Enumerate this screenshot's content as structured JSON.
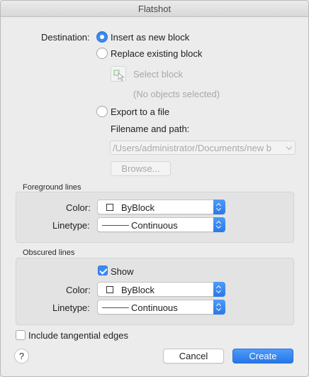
{
  "window": {
    "title": "Flatshot"
  },
  "destination": {
    "label": "Destination:",
    "insert_label": "Insert as new block",
    "replace_label": "Replace existing block",
    "select_block_label": "Select block",
    "no_objects_label": "(No objects selected)",
    "export_label": "Export to a file",
    "filename_label": "Filename and path:",
    "filename_value": "/Users/administrator/Documents/new b",
    "browse_label": "Browse...",
    "selected": "insert"
  },
  "foreground": {
    "title": "Foreground lines",
    "color_label": "Color:",
    "color_value": "ByBlock",
    "linetype_label": "Linetype:",
    "linetype_value": "Continuous"
  },
  "obscured": {
    "title": "Obscured lines",
    "show_label": "Show",
    "show_checked": true,
    "color_label": "Color:",
    "color_value": "ByBlock",
    "linetype_label": "Linetype:",
    "linetype_value": "Continuous"
  },
  "tangential": {
    "label": "Include tangential edges",
    "checked": false
  },
  "footer": {
    "help_label": "?",
    "cancel_label": "Cancel",
    "create_label": "Create"
  },
  "colors": {
    "accent": "#3b89f5",
    "window_bg": "#ececec",
    "group_bg": "#e3e3e3"
  },
  "icons": [
    "radio-selected",
    "radio-unselected",
    "select-block-icon",
    "chevron-down-icon",
    "stepper-icon",
    "checkbox-checked",
    "checkbox-unchecked",
    "help-icon"
  ]
}
